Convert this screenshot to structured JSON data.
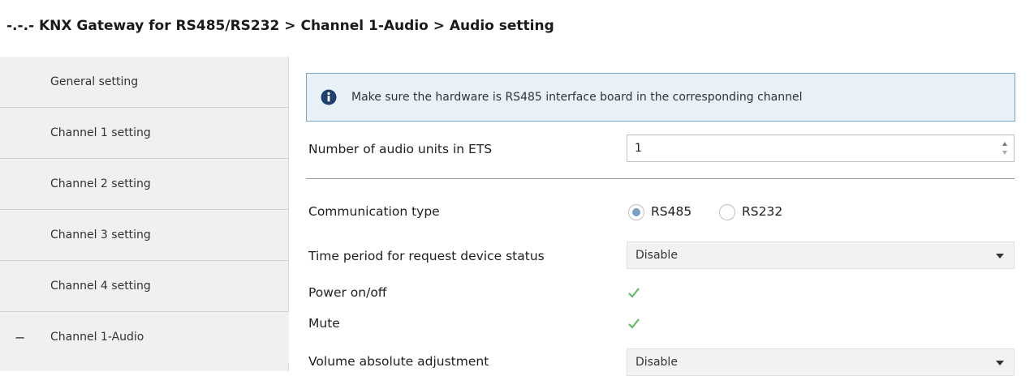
{
  "breadcrumb": {
    "title": "-.-.- KNX Gateway for RS485/RS232 > Channel 1-Audio > Audio setting"
  },
  "sidebar": {
    "items": [
      {
        "label": "General setting"
      },
      {
        "label": "Channel 1 setting"
      },
      {
        "label": "Channel 2 setting"
      },
      {
        "label": "Channel 3 setting"
      },
      {
        "label": "Channel 4 setting"
      },
      {
        "label": "Channel 1-Audio",
        "expand_glyph": "−"
      }
    ]
  },
  "info": {
    "icon": "info-icon",
    "text": "Make sure the hardware is RS485 interface board in the corresponding channel"
  },
  "settings": {
    "audio_units": {
      "label": "Number of audio units in ETS",
      "value": "1"
    },
    "communication_type": {
      "label": "Communication type",
      "options": [
        {
          "label": "RS485",
          "selected": true
        },
        {
          "label": "RS232",
          "selected": false
        }
      ]
    },
    "request_period": {
      "label": "Time period for request device status",
      "value": "Disable"
    },
    "power": {
      "label": "Power on/off",
      "checked": true
    },
    "mute": {
      "label": "Mute",
      "checked": true
    },
    "volume": {
      "label": "Volume absolute adjustment",
      "value": "Disable"
    }
  },
  "colors": {
    "info_bg": "#e8f1f8",
    "info_border": "#7ba7c9",
    "check_green": "#5cb85c",
    "radio_selected": "#7a9ec4"
  }
}
